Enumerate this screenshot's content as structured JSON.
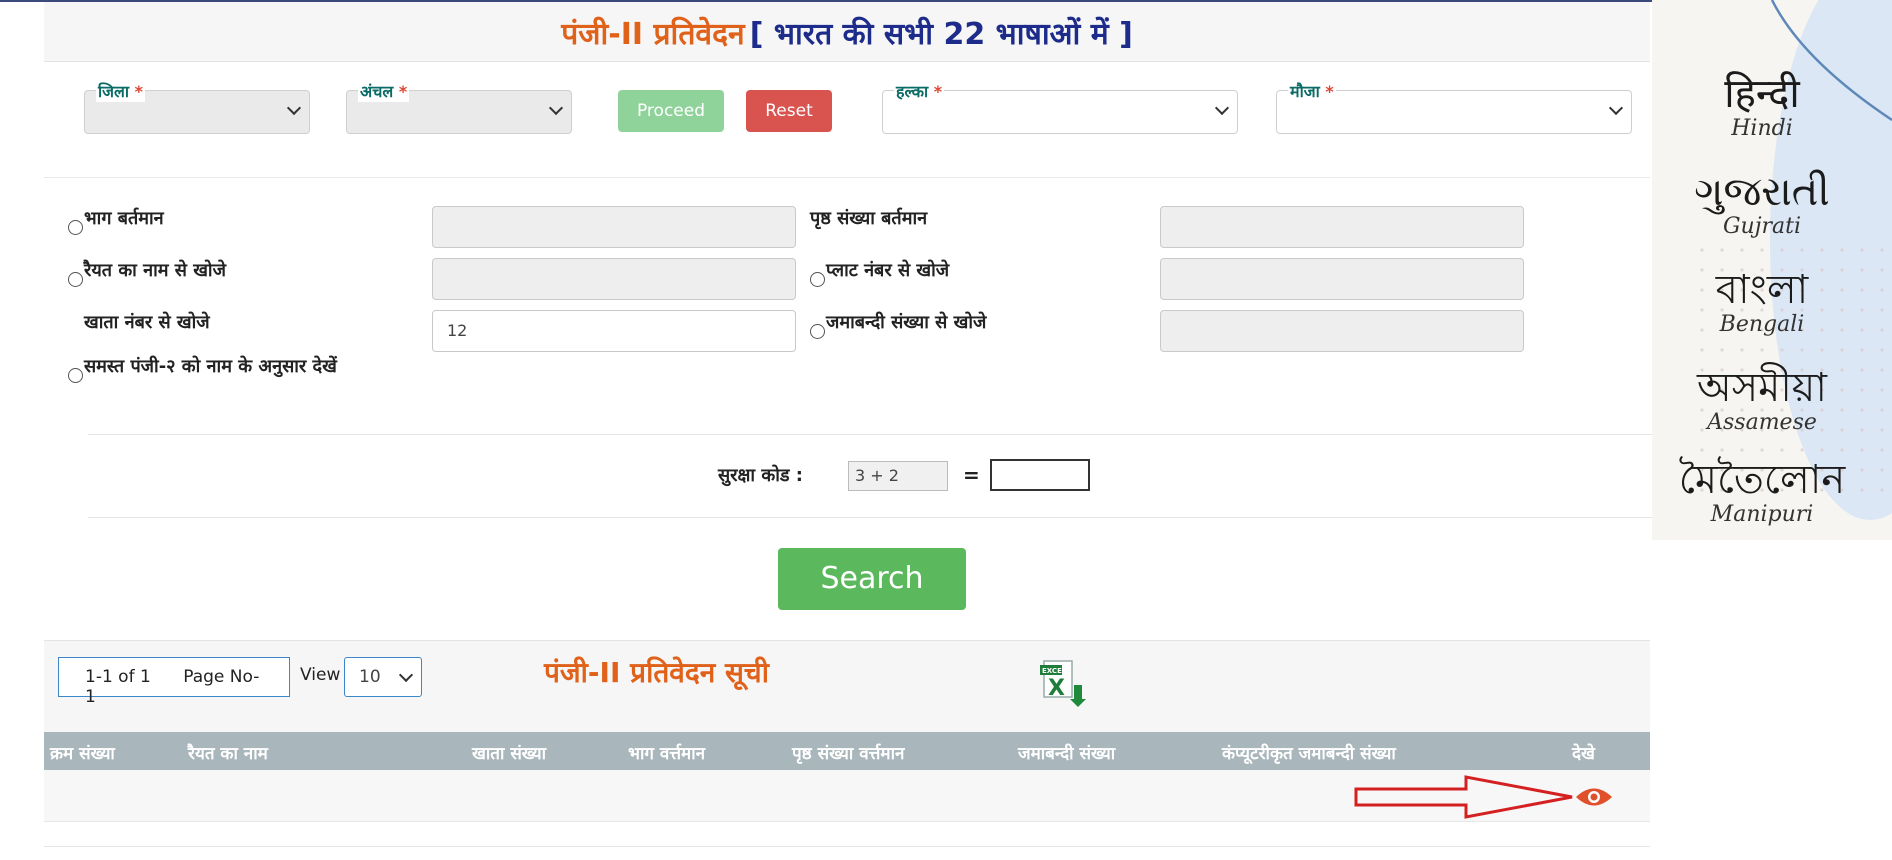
{
  "header": {
    "title_main": "पंजी-II प्रतिवेदन",
    "title_sub": "[ भारत की सभी 22 भाषाओं में ]"
  },
  "filters": {
    "district_label": "जिला",
    "zone_label": "अंचल",
    "halka_label": "हल्का",
    "mauja_label": "मौजा",
    "required_mark": "*",
    "proceed_label": "Proceed",
    "reset_label": "Reset"
  },
  "search_options": {
    "bhag_label": "भाग बर्तमान",
    "page_label": "पृष्ठ संख्या बर्तमान",
    "raiyat_label": "रैयत का नाम से खोजे",
    "plot_label": "प्लाट नंबर से खोजे",
    "khata_label": "खाता नंबर से खोजे",
    "khata_value": "12",
    "jamabandi_label": "जमाबन्दी संख्या से खोजे",
    "all_label": "समस्त पंजी-२ को नाम के अनुसार देखें"
  },
  "captcha": {
    "label": "सुरक्षा कोड :",
    "code": "3 + 2",
    "equals": "="
  },
  "search_button": "Search",
  "list": {
    "pager_text": "1-1 of 1",
    "page_text": "Page No- 1",
    "view_label": "View",
    "view_value": "10",
    "title": "पंजी-II प्रतिवेदन सूची",
    "excel_icon_text": "EXCEL",
    "columns": [
      "क्रम संख्या",
      "रैयत का नाम",
      "खाता संख्या",
      "भाग वर्त्तमान",
      "पृष्ठ संख्या वर्त्तमान",
      "जमाबन्दी संख्या",
      "कंप्यूटरीकृत जमाबन्दी संख्या",
      "देखे"
    ]
  },
  "languages": [
    {
      "native": "हिन्दी",
      "english": "Hindi"
    },
    {
      "native": "ગુજરાતી",
      "english": "Gujrati"
    },
    {
      "native": "বাংলা",
      "english": "Bengali"
    },
    {
      "native": "অসমীয়া",
      "english": "Assamese"
    },
    {
      "native": "মৈতৈলোন",
      "english": "Manipuri"
    }
  ],
  "colors": {
    "title_orange": "#e0621a",
    "title_blue": "#1d2c8a",
    "search_green": "#5cb85c",
    "reset_red": "#d9534f",
    "table_header": "#a9b6bb",
    "label_teal": "#0b6b66"
  }
}
